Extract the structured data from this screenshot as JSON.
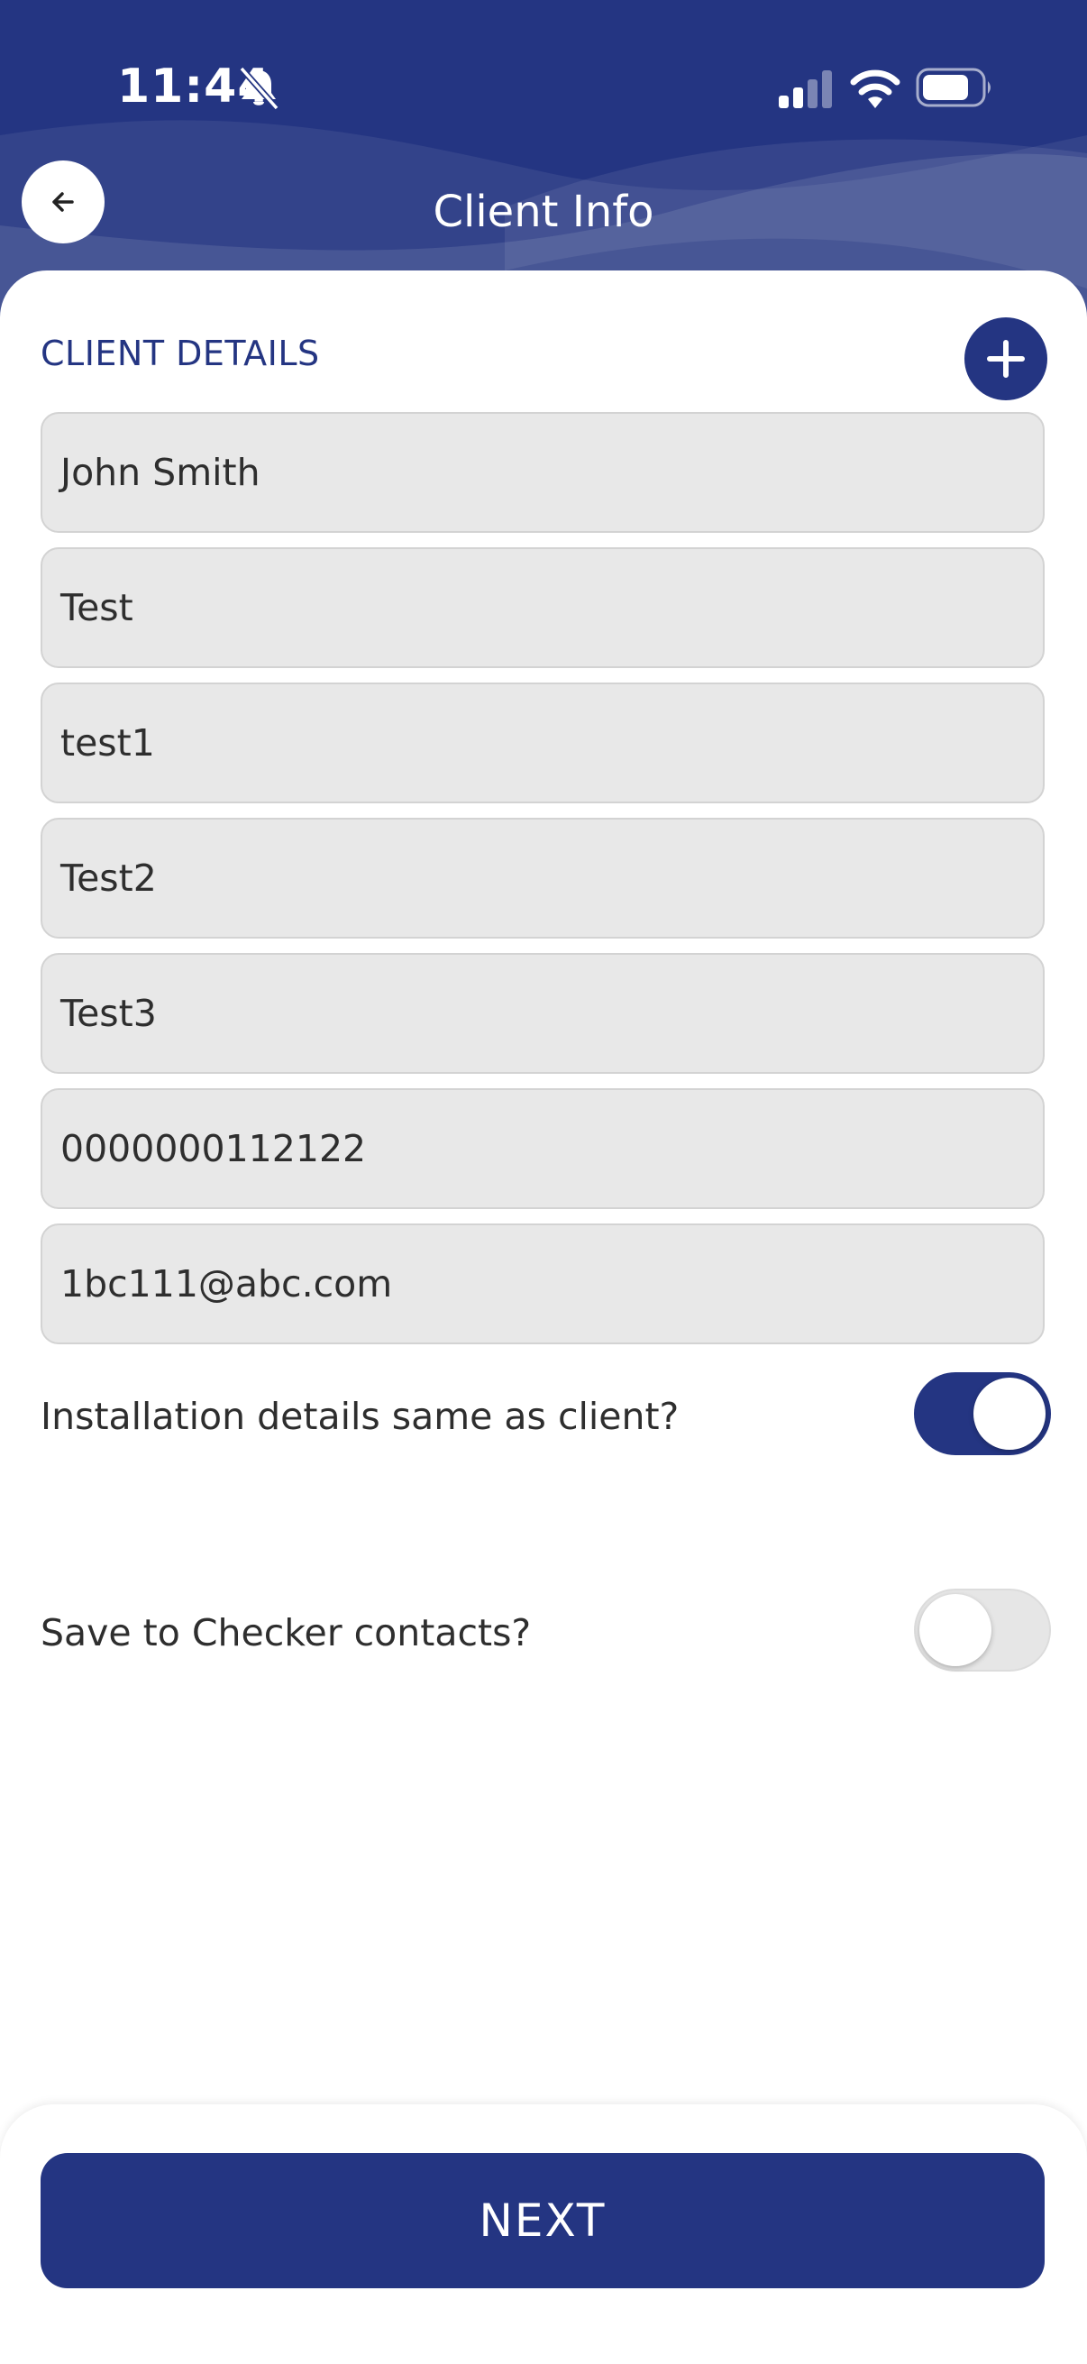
{
  "status_bar": {
    "time": "11:44"
  },
  "header": {
    "title": "Client Info"
  },
  "client_details": {
    "section_title": "CLIENT DETAILS",
    "fields": [
      "John Smith",
      "Test",
      "test1",
      "Test2",
      "Test3",
      "0000000112122",
      "1bc111@abc.com"
    ]
  },
  "toggles": {
    "installation_same": {
      "label": "Installation details same as client?",
      "on": true
    },
    "save_contacts": {
      "label": "Save to Checker contacts?",
      "on": false
    }
  },
  "footer": {
    "next_label": "NEXT"
  },
  "colors": {
    "primary": "#243582",
    "field_bg": "#e8e8e8",
    "text": "#2e2e2e"
  },
  "icons": {
    "back": "arrow-left-icon",
    "add": "plus-icon",
    "bell": "bell-slash-icon",
    "signal": "cellular-signal-icon",
    "wifi": "wifi-icon",
    "battery": "battery-icon"
  }
}
